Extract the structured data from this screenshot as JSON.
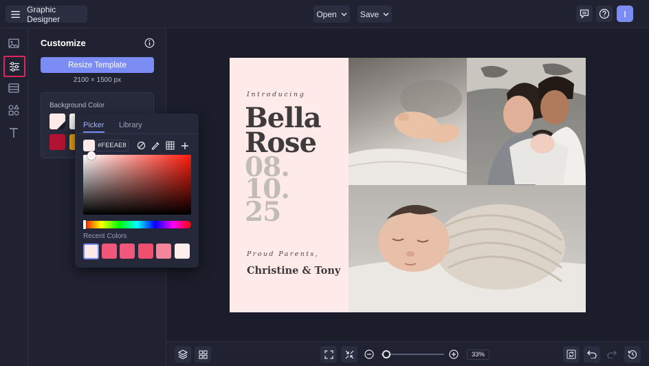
{
  "app": {
    "title": "Graphic Designer",
    "user_initial": "I"
  },
  "topbar": {
    "open_label": "Open",
    "save_label": "Save"
  },
  "panel": {
    "title": "Customize",
    "resize_label": "Resize Template",
    "dimensions": "2100 × 1500 px",
    "bg_label": "Background Color"
  },
  "picker": {
    "tabs": [
      "Picker",
      "Library"
    ],
    "hex_value": "#FEEAE8",
    "recent_label": "Recent Colors",
    "recent_colors": [
      "#feeae8",
      "#f0577a",
      "#f0577a",
      "#f04e6e",
      "#f4869c",
      "#fbeeed"
    ]
  },
  "design": {
    "introducing": "Introducing",
    "name_line1": "Bella",
    "name_line2": "Rose",
    "date_line1": "08.",
    "date_line2": "10.",
    "date_line3": "25",
    "proud": "Proud Parents,",
    "parents": "Christine & Tony"
  },
  "bottombar": {
    "zoom": "33%"
  },
  "colors": {
    "accent": "#7b8cf5",
    "highlight": "#e0245e",
    "canvas_bg": "#feeae8"
  }
}
